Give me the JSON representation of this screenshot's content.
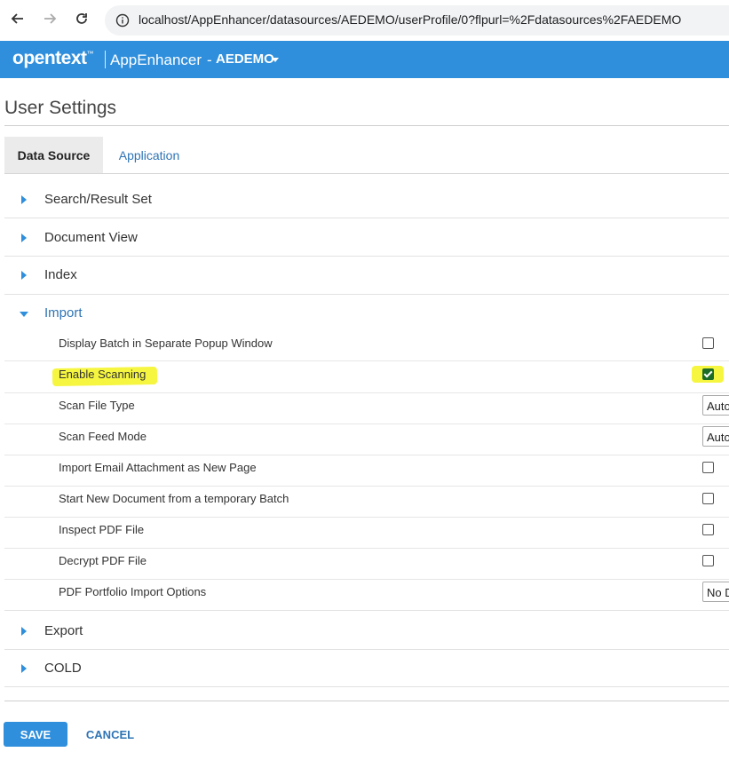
{
  "browser": {
    "url": "localhost/AppEnhancer/datasources/AEDEMO/userProfile/0?flpurl=%2Fdatasources%2FAEDEMO"
  },
  "header": {
    "brand": "opentext",
    "trademark": "™",
    "app_name": "AppEnhancer",
    "datasource_dash": "-",
    "datasource": "AEDEMO",
    "accent_color": "#2f8fdc"
  },
  "page": {
    "title": "User Settings"
  },
  "tabs": [
    {
      "label": "Data Source",
      "active": true
    },
    {
      "label": "Application",
      "active": false
    }
  ],
  "sections": {
    "search": {
      "label": "Search/Result Set",
      "expanded": false
    },
    "document_view": {
      "label": "Document View",
      "expanded": false
    },
    "index": {
      "label": "Index",
      "expanded": false
    },
    "import": {
      "label": "Import",
      "expanded": true
    },
    "export": {
      "label": "Export",
      "expanded": false
    },
    "cold": {
      "label": "COLD",
      "expanded": false
    }
  },
  "import_settings": [
    {
      "label": "Display Batch in Separate Popup Window",
      "control": "checkbox",
      "checked": false
    },
    {
      "label": "Enable Scanning",
      "control": "checkbox",
      "checked": true,
      "highlighted": true
    },
    {
      "label": "Scan File Type",
      "control": "select",
      "value": "Auto"
    },
    {
      "label": "Scan Feed Mode",
      "control": "select",
      "value": "Auto"
    },
    {
      "label": "Import Email Attachment as New Page",
      "control": "checkbox",
      "checked": false
    },
    {
      "label": "Start New Document from a temporary Batch",
      "control": "checkbox",
      "checked": false
    },
    {
      "label": "Inspect PDF File",
      "control": "checkbox",
      "checked": false
    },
    {
      "label": "Decrypt PDF File",
      "control": "checkbox",
      "checked": false
    },
    {
      "label": "PDF Portfolio Import Options",
      "control": "select",
      "value": "No D"
    }
  ],
  "footer": {
    "save_label": "SAVE",
    "cancel_label": "CANCEL"
  }
}
